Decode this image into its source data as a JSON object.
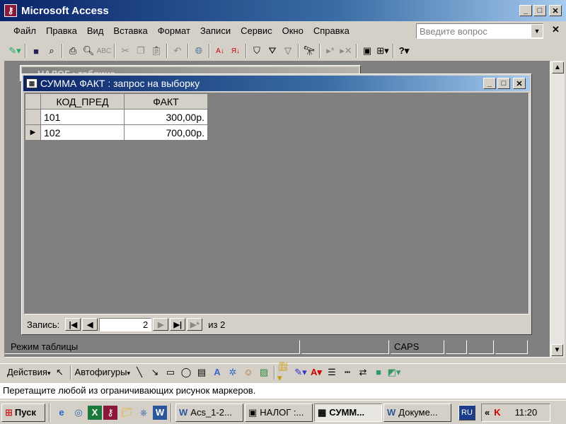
{
  "app": {
    "title": "Microsoft Access"
  },
  "menu": {
    "items": [
      "Файл",
      "Правка",
      "Вид",
      "Вставка",
      "Формат",
      "Записи",
      "Сервис",
      "Окно",
      "Справка"
    ],
    "help_placeholder": "Введите вопрос"
  },
  "toolbar": {
    "icons": [
      "view-design-icon",
      "save-icon",
      "search-db-icon",
      "print-icon",
      "print-preview-icon",
      "spelling-icon",
      "cut-icon",
      "copy-icon",
      "paste-icon",
      "undo-icon",
      "hyperlink-icon",
      "sort-ascending-icon",
      "sort-descending-icon",
      "filter-selection-icon",
      "filter-form-icon",
      "apply-filter-icon",
      "find-icon",
      "new-record-icon",
      "delete-record-icon",
      "database-window-icon",
      "new-object-icon",
      "help-icon"
    ]
  },
  "bg_window": {
    "title": "НАЛОГ : таблица"
  },
  "query_window": {
    "title": "СУММА ФАКТ : запрос на выборку",
    "columns": [
      "КОД_ПРЕД",
      "ФАКТ"
    ],
    "rows": [
      {
        "kod": "101",
        "fakt": "300,00р."
      },
      {
        "kod": "102",
        "fakt": "700,00р."
      }
    ],
    "record_label": "Запись:",
    "current_record": "2",
    "total_label": "из 2"
  },
  "status": {
    "mode": "Режим таблицы",
    "caps": "CAPS"
  },
  "drawing_toolbar": {
    "actions_label": "Действия",
    "autoshapes_label": "Автофигуры"
  },
  "hint_text": "Перетащите любой из ограничивающих рисунок маркеров.",
  "taskbar": {
    "start_label": "Пуск",
    "buttons": [
      "Acs_1-2...",
      "НАЛОГ :...",
      "СУММ...",
      "Докуме..."
    ],
    "lang": "RU",
    "clock": "11:20"
  },
  "colors": {
    "titlebar_active": "#0a246a",
    "mdi_background": "#808080",
    "desktop": "#d4d0c8"
  }
}
